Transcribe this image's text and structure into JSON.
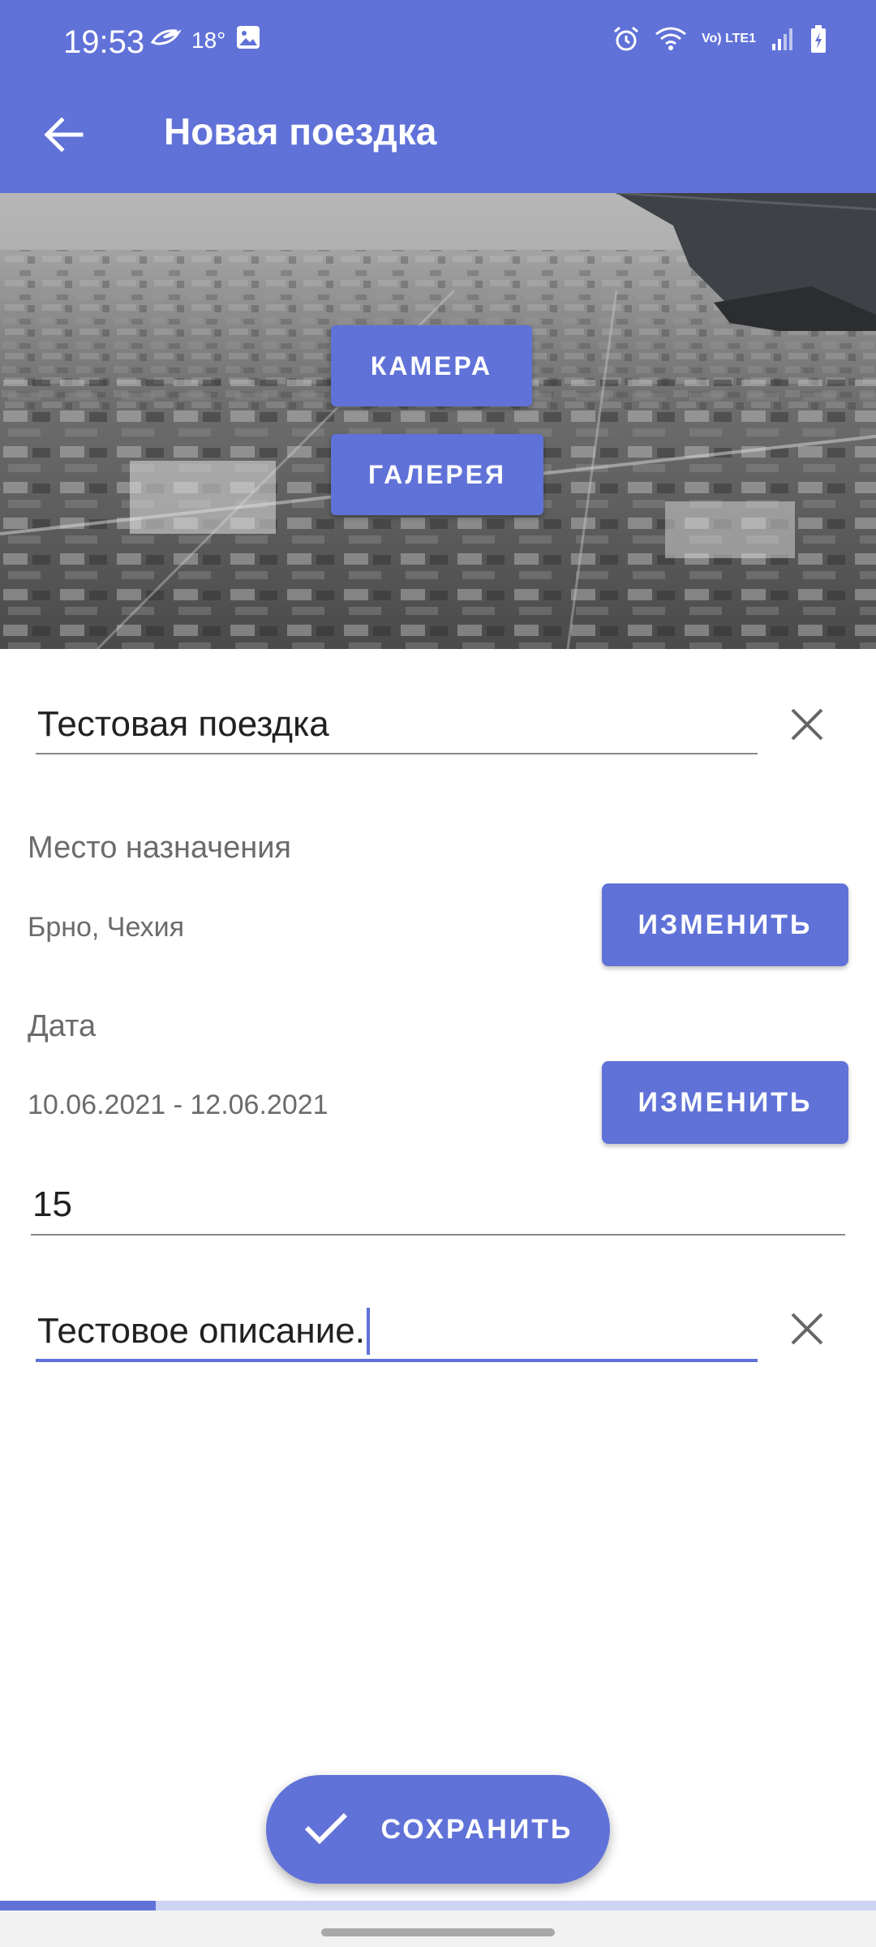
{
  "status_bar": {
    "time": "19:53",
    "temperature": "18°",
    "network_label": "Vo) LTE1",
    "icons": [
      "weather-icon",
      "image-icon",
      "alarm-icon",
      "wifi-icon",
      "signal-icon",
      "battery-charging-icon"
    ]
  },
  "app_bar": {
    "title": "Новая поездка",
    "back_icon": "arrow-back-icon"
  },
  "header_image": {
    "description_icon": "aerial-city-photo",
    "camera_label": "КАМЕРА",
    "gallery_label": "ГАЛЕРЕЯ"
  },
  "form": {
    "trip_name": {
      "value": "Тестовая поездка",
      "clear_icon": "close-icon"
    },
    "destination": {
      "label": "Место назначения",
      "value": "Брно, Чехия",
      "button_label": "ИЗМЕНИТЬ"
    },
    "date": {
      "label": "Дата",
      "value": "10.06.2021 - 12.06.2021",
      "button_label": "ИЗМЕНИТЬ"
    },
    "number": {
      "value": "15"
    },
    "description": {
      "value": "Тестовое описание.",
      "clear_icon": "close-icon"
    }
  },
  "fab": {
    "label": "СОХРАНИТЬ",
    "icon": "check-icon"
  },
  "progress": {
    "fraction": 0.178
  },
  "colors": {
    "primary": "#6072d8",
    "text": "#212121",
    "secondary_text": "#6b6b6b",
    "track": "#cdd3f2"
  }
}
